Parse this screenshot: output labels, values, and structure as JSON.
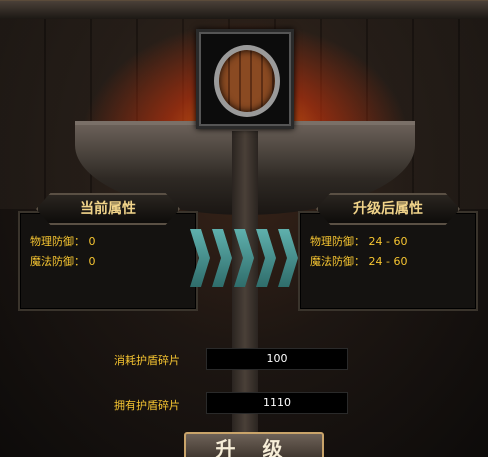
{
  "current_attributes": {
    "title": "当前属性",
    "physical_defense": "物理防御： 0",
    "magic_defense": "魔法防御： 0"
  },
  "upgraded_attributes": {
    "title": "升级后属性",
    "physical_defense": "物理防御： 24 - 60",
    "magic_defense": "魔法防御： 24 - 60"
  },
  "cost": {
    "label": "消耗护盾碎片",
    "value": "100"
  },
  "owned": {
    "label": "拥有护盾碎片",
    "value": "1110"
  },
  "upgrade_button": "升 级",
  "icons": {
    "item": "wooden-shield-icon",
    "arrows": "chevron-right-icon"
  }
}
